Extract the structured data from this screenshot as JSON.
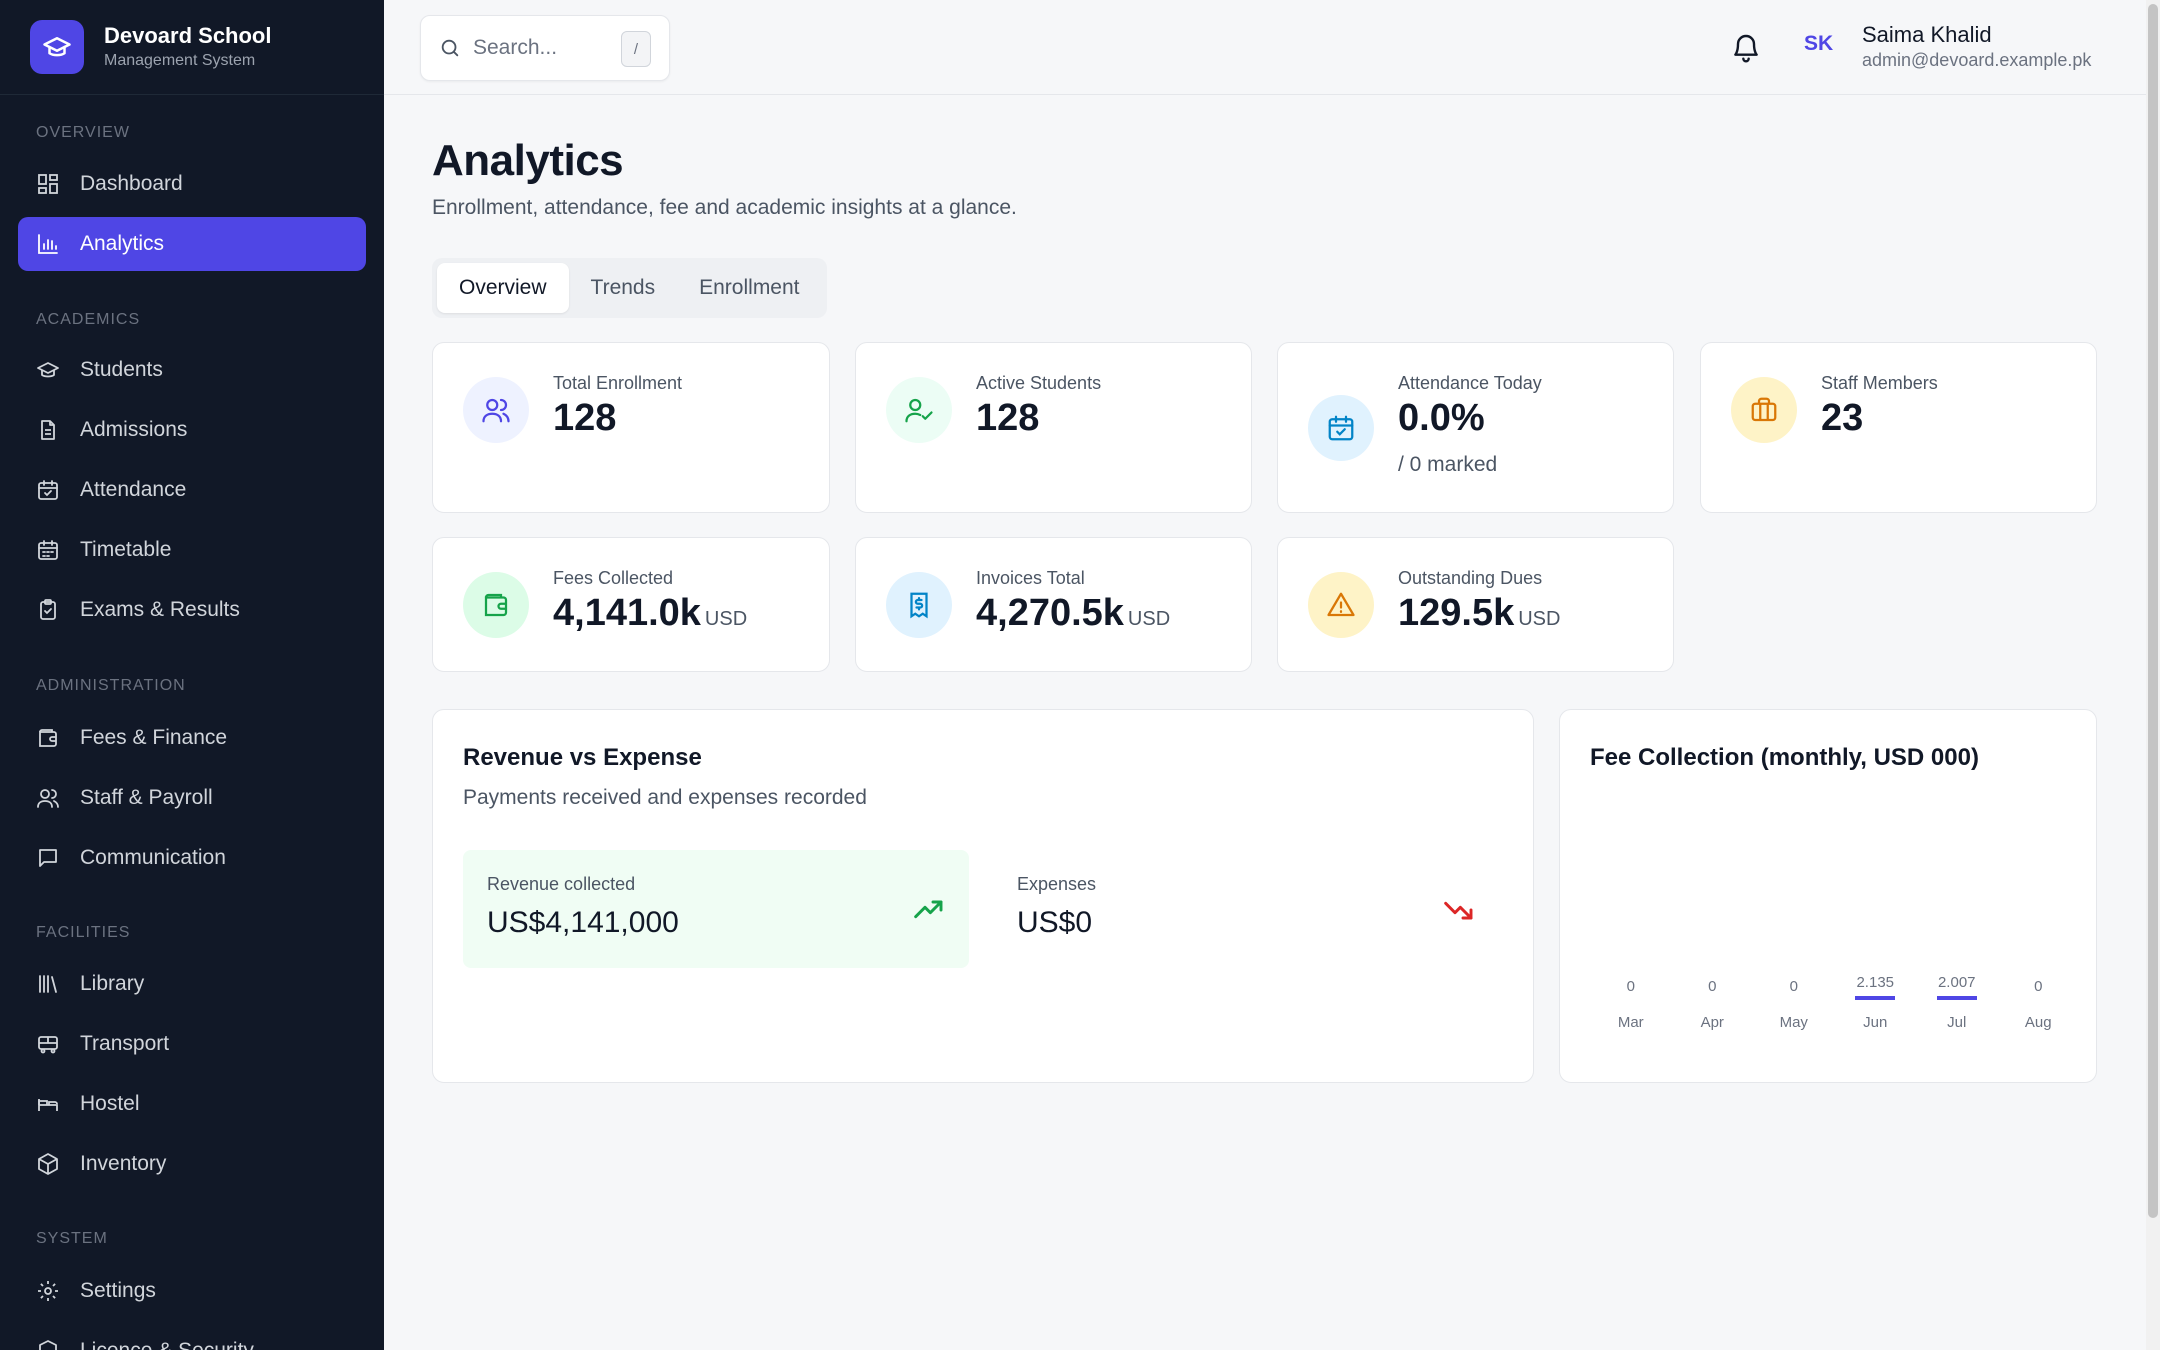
{
  "brand": {
    "title": "Devoard School",
    "subtitle": "Management System"
  },
  "sidebar": {
    "sections": [
      {
        "label": "OVERVIEW"
      },
      {
        "label": "ACADEMICS"
      },
      {
        "label": "ADMINISTRATION"
      },
      {
        "label": "FACILITIES"
      },
      {
        "label": "SYSTEM"
      }
    ],
    "items": [
      {
        "label": "Dashboard",
        "icon": "grid-icon"
      },
      {
        "label": "Analytics",
        "icon": "bar-chart-icon",
        "active": true
      },
      {
        "label": "Students",
        "icon": "graduation-cap-icon"
      },
      {
        "label": "Admissions",
        "icon": "document-icon"
      },
      {
        "label": "Attendance",
        "icon": "calendar-check-icon"
      },
      {
        "label": "Timetable",
        "icon": "calendar-icon"
      },
      {
        "label": "Exams & Results",
        "icon": "clipboard-icon"
      },
      {
        "label": "Fees & Finance",
        "icon": "wallet-icon"
      },
      {
        "label": "Staff & Payroll",
        "icon": "users-icon"
      },
      {
        "label": "Communication",
        "icon": "message-icon"
      },
      {
        "label": "Library",
        "icon": "library-icon"
      },
      {
        "label": "Transport",
        "icon": "bus-icon"
      },
      {
        "label": "Hostel",
        "icon": "bed-icon"
      },
      {
        "label": "Inventory",
        "icon": "box-icon"
      },
      {
        "label": "Settings",
        "icon": "gear-icon"
      },
      {
        "label": "Licence & Security",
        "icon": "shield-icon"
      }
    ]
  },
  "topbar": {
    "search_placeholder": "Search...",
    "search_shortcut": "/",
    "user": {
      "initials": "SK",
      "name": "Saima Khalid",
      "email": "admin@devoard.example.pk"
    }
  },
  "page": {
    "title": "Analytics",
    "subtitle": "Enrollment, attendance, fee and academic insights at a glance.",
    "tabs": [
      {
        "label": "Overview",
        "active": true
      },
      {
        "label": "Trends"
      },
      {
        "label": "Enrollment"
      }
    ]
  },
  "stats": [
    {
      "label": "Total Enrollment",
      "value": "128",
      "unit": "",
      "note": "",
      "icon": "users-icon",
      "color": "#4f46e5"
    },
    {
      "label": "Active Students",
      "value": "128",
      "unit": "",
      "note": "",
      "icon": "user-check-icon",
      "color": "#16a34a"
    },
    {
      "label": "Attendance Today",
      "value": "0.0%",
      "unit": "",
      "note": "/ 0 marked",
      "icon": "calendar-check-icon",
      "color": "#0284c7"
    },
    {
      "label": "Staff Members",
      "value": "23",
      "unit": "",
      "note": "",
      "icon": "briefcase-icon",
      "color": "#d97706"
    },
    {
      "label": "Fees Collected",
      "value": "4,141.0k",
      "unit": "USD",
      "note": "",
      "icon": "wallet-icon",
      "color": "#16a34a"
    },
    {
      "label": "Invoices Total",
      "value": "4,270.5k",
      "unit": "USD",
      "note": "",
      "icon": "receipt-icon",
      "color": "#0284c7"
    },
    {
      "label": "Outstanding Dues",
      "value": "129.5k",
      "unit": "USD",
      "note": "",
      "icon": "warning-icon",
      "color": "#d97706"
    }
  ],
  "revenue_panel": {
    "title": "Revenue vs Expense",
    "subtitle": "Payments received and expenses recorded",
    "revenue_label": "Revenue collected",
    "revenue_value": "US$4,141,000",
    "expense_label": "Expenses",
    "expense_value": "US$0"
  },
  "fee_panel": {
    "title": "Fee Collection (monthly, USD 000)"
  },
  "chart_data": {
    "type": "bar",
    "title": "Fee Collection (monthly, USD 000)",
    "categories": [
      "Mar",
      "Apr",
      "May",
      "Jun",
      "Jul",
      "Aug"
    ],
    "values": [
      0,
      0,
      0,
      2.135,
      2.007,
      0
    ],
    "value_labels": [
      "0",
      "0",
      "0",
      "2.135",
      "2.007",
      "0"
    ],
    "xlabel": "",
    "ylabel": "",
    "grid": false
  }
}
